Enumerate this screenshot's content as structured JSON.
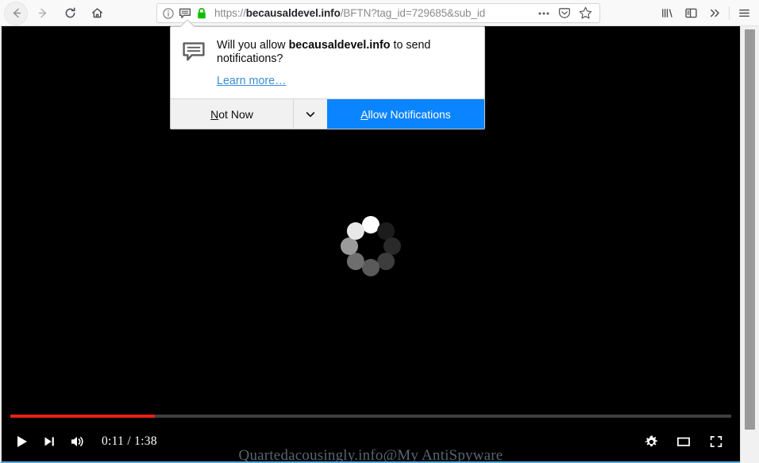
{
  "browser": {
    "nav": {
      "back_label": "Back",
      "forward_label": "Forward",
      "reload_label": "Reload",
      "home_label": "Home"
    },
    "urlbar": {
      "identity_info_icon": "info-circle-icon",
      "identity_notification_icon": "notification-bubble-icon",
      "identity_lock_icon": "padlock-icon",
      "url_scheme": "https://",
      "url_host": "becausaldevel.info",
      "url_path": "/BFTN?tag_id=729685&sub_id",
      "page_actions_icon": "ellipsis-icon",
      "pocket_icon": "pocket-icon",
      "bookmark_icon": "star-icon"
    },
    "toolbar_right": {
      "library_icon": "library-icon",
      "sidebar_icon": "sidebar-icon",
      "overflow_icon": "double-chevron-right-icon",
      "menu_icon": "hamburger-menu-icon"
    }
  },
  "doorhanger": {
    "icon": "notification-bubble-icon",
    "question_prefix": "Will you allow ",
    "question_host": "becausaldevel.info",
    "question_suffix": " to send notifications?",
    "learn_more": "Learn more…",
    "not_now_label_first": "N",
    "not_now_label_rest": "ot Now",
    "dropdown_icon": "chevron-down-icon",
    "allow_label_first": "A",
    "allow_label_rest": "llow Notifications",
    "accent_color": "#0a84ff"
  },
  "page": {
    "background_color": "#000000",
    "spinner": {
      "name": "loading-spinner",
      "dot_count": 8,
      "dot_shades": [
        "#ffffff",
        "#1c1c1c",
        "#2a2a2a",
        "#3d3d3d",
        "#5a5a5a",
        "#6e6e6e",
        "#9a9a9a",
        "#e8e8e8"
      ]
    },
    "watermark": "Quartedacousingly.info@My AntiSpyware"
  },
  "player": {
    "progress_percent": 20,
    "progress_color": "#e62117",
    "play_icon": "play-icon",
    "next_icon": "next-track-icon",
    "volume_icon": "volume-icon",
    "time_display": "0:11 / 1:38",
    "current_time": "0:11",
    "duration": "1:38",
    "settings_icon": "gear-icon",
    "theater_icon": "theater-mode-icon",
    "fullscreen_icon": "fullscreen-icon"
  },
  "scrollbar": {
    "name": "page-scrollbar",
    "thumb_name": "page-scrollbar-thumb"
  }
}
